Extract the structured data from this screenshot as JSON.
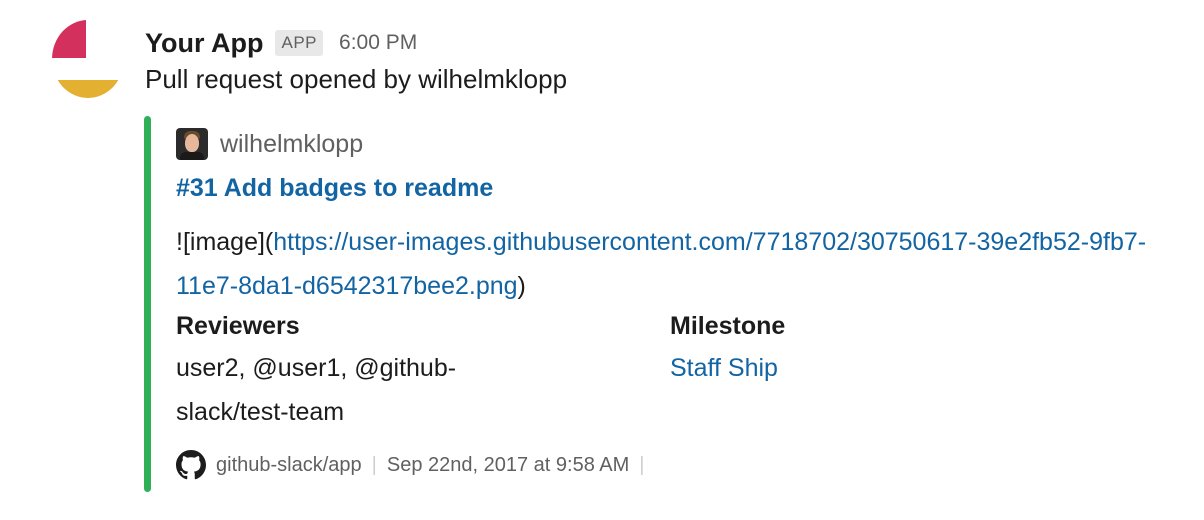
{
  "message": {
    "app_name": "Your App",
    "app_badge": "APP",
    "timestamp": "6:00 PM",
    "text": "Pull request opened by wilhelmklopp",
    "avatar_colors": {
      "red": "#d4305d",
      "yellow": "#e4b031"
    }
  },
  "attachment": {
    "accent_color": "#2fb057",
    "author_name": "wilhelmklopp",
    "title": "#31 Add badges to readme",
    "body_prefix": "![image](",
    "body_link": "https://user-images.githubusercontent.com/7718702/30750617-39e2fb52-9fb7-11e7-8da1-d6542317bee2.png",
    "body_suffix": ")",
    "fields": [
      {
        "title": "Reviewers",
        "value": "user2, @user1, @github-slack/test-team"
      },
      {
        "title": "Milestone",
        "value": "Staff Ship"
      }
    ],
    "footer": {
      "icon": "github-icon",
      "source": "github-slack/app",
      "separator": "|",
      "datetime": "Sep 22nd, 2017 at 9:58 AM"
    }
  }
}
